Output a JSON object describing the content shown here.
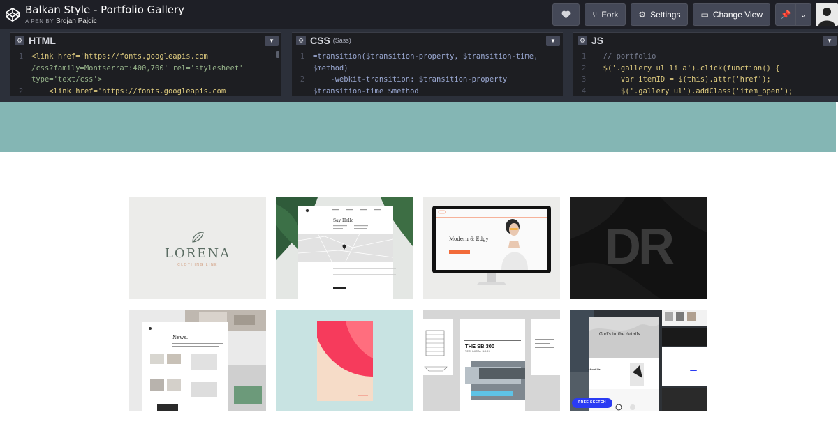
{
  "header": {
    "title": "Balkan Style - Portfolio Gallery",
    "by_prefix": "A PEN BY",
    "author": "Srdjan Pajdic",
    "fork_label": "Fork",
    "settings_label": "Settings",
    "change_view_label": "Change View"
  },
  "editors": {
    "html": {
      "title": "HTML",
      "lines": [
        {
          "n": "1",
          "t": "<link href='https://fonts.googleapis.com"
        },
        {
          "n": "",
          "t": "/css?family=Montserrat:400,700' rel='stylesheet'"
        },
        {
          "n": "",
          "t": "type='text/css'>"
        },
        {
          "n": "2",
          "t": "    <link href='https://fonts.googleapis.com"
        }
      ]
    },
    "css": {
      "title": "CSS",
      "subtitle": "(Sass)",
      "lines": [
        {
          "n": "1",
          "t": "=transition($transition-property, $transition-time,"
        },
        {
          "n": "",
          "t": "$method)"
        },
        {
          "n": "2",
          "t": "    -webkit-transition: $transition-property"
        },
        {
          "n": "",
          "t": "$transition-time $method"
        }
      ]
    },
    "js": {
      "title": "JS",
      "lines": [
        {
          "n": "1",
          "t": "  // portfolio"
        },
        {
          "n": "2",
          "t": "  $('.gallery ul li a').click(function() {"
        },
        {
          "n": "3",
          "t": "      var itemID = $(this).attr('href');"
        },
        {
          "n": "4",
          "t": "      $('.gallery ul').addClass('item_open');"
        }
      ]
    }
  },
  "gallery": {
    "lorena_title": "LORENA",
    "lorena_sub": "CLOTHING LINE",
    "hello_title": "Say Hello",
    "modern_title": "Modern & Edgy",
    "dr_text": "DR",
    "news_title": "News.",
    "sb_title": "THE SB 300",
    "sb_sub": "TECHNICAL BOOK",
    "gods_title": "God's in the details",
    "free_sketch": "FREE SKETCH",
    "about_title": "About Us"
  },
  "colors": {
    "topbar": "#1e1f26",
    "editor_bg": "#1d1e22",
    "hero": "#84b6b4",
    "accent_orange": "#f26b3a",
    "button_blue": "#2a3bf3"
  }
}
